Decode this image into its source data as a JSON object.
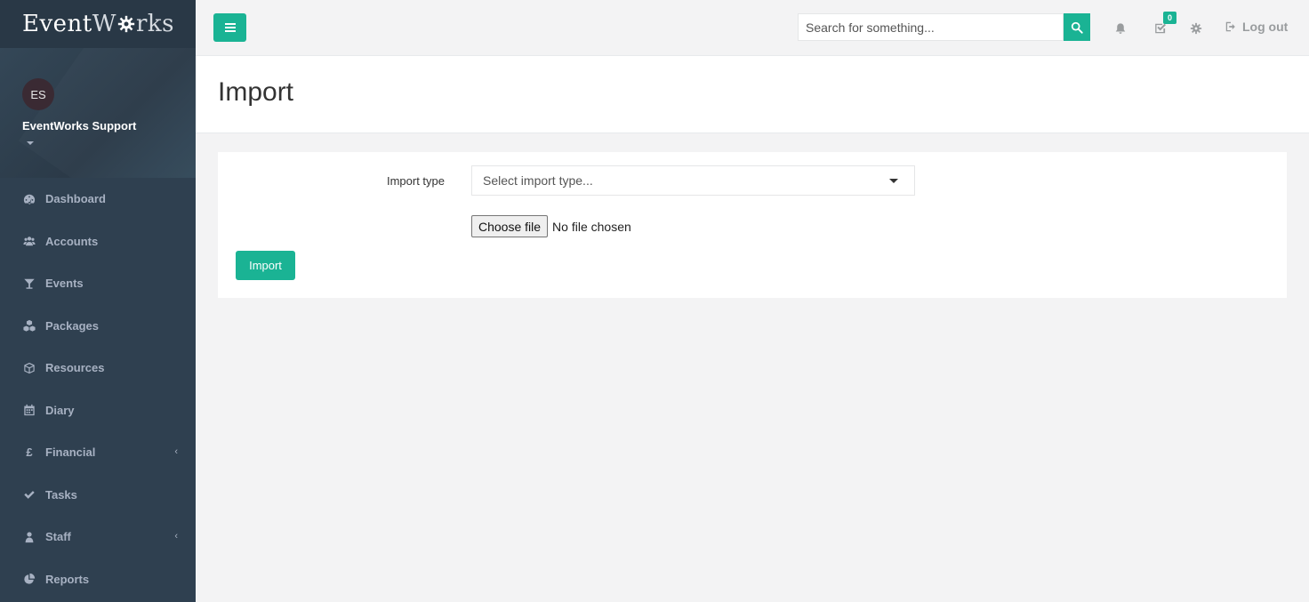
{
  "brand": {
    "part1": "Event",
    "part2": "W",
    "part3": "rks"
  },
  "profile": {
    "initials": "ES",
    "name": "EventWorks Support"
  },
  "sidebar": {
    "items": [
      {
        "label": "Dashboard",
        "icon": "dashboard-icon",
        "has_children": false
      },
      {
        "label": "Accounts",
        "icon": "users-icon",
        "has_children": false
      },
      {
        "label": "Events",
        "icon": "glass-icon",
        "has_children": false
      },
      {
        "label": "Packages",
        "icon": "cubes-icon",
        "has_children": false
      },
      {
        "label": "Resources",
        "icon": "cube-icon",
        "has_children": false
      },
      {
        "label": "Diary",
        "icon": "calendar-icon",
        "has_children": false
      },
      {
        "label": "Financial",
        "icon": "pound-icon",
        "has_children": true
      },
      {
        "label": "Tasks",
        "icon": "check-icon",
        "has_children": false
      },
      {
        "label": "Staff",
        "icon": "user-icon",
        "has_children": true
      },
      {
        "label": "Reports",
        "icon": "pie-chart-icon",
        "has_children": false
      }
    ]
  },
  "topbar": {
    "search_placeholder": "Search for something...",
    "tasks_badge": "0",
    "logout_label": "Log out"
  },
  "page": {
    "title": "Import"
  },
  "form": {
    "import_type_label": "Import type",
    "import_type_placeholder": "Select import type...",
    "file_button_label": "Choose file",
    "file_status": "No file chosen",
    "submit_label": "Import"
  },
  "colors": {
    "accent": "#1ab394",
    "sidebar": "#2f4050",
    "sidebar_text": "#a7b1c2"
  }
}
